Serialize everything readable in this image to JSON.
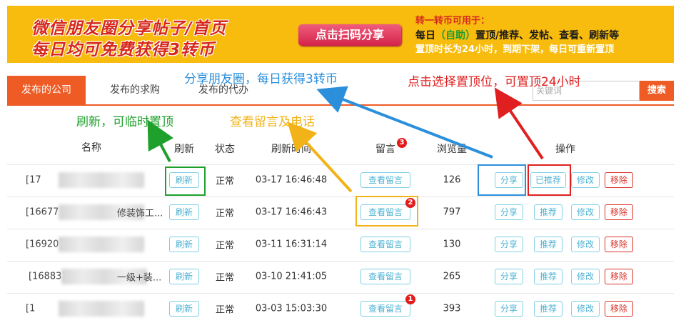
{
  "banner": {
    "title_line1": "微信朋友圈分享帖子/首页",
    "title_line2": "每日均可免费获得3转币",
    "scan_button": "点击扫码分享",
    "info_line1": "转一转币可用于：",
    "info_line2_a": "每日",
    "info_line2_b": "（自助）",
    "info_line2_c": "置顶/推荐、发帖、查看、刷新等",
    "info_line3": "置顶时长为24小时，到期下架，每日可重新置顶"
  },
  "tabs": [
    "发布的公司",
    "发布的求购",
    "发布的代办"
  ],
  "search": {
    "placeholder": "关键词",
    "button": "搜索"
  },
  "headers": {
    "name": "名称",
    "refresh": "刷新",
    "status": "状态",
    "refresh_time": "刷新时间",
    "messages": "留言",
    "views": "浏览量",
    "actions": "操作"
  },
  "header_badge": "3",
  "buttons": {
    "refresh": "刷新",
    "view_messages": "查看留言",
    "share": "分享",
    "recommend": "推荐",
    "recommended": "已推荐",
    "edit": "修改",
    "remove": "移除"
  },
  "rows": [
    {
      "name_visible": "[17",
      "name_tail": "",
      "status": "正常",
      "time": "03-17 16:46:48",
      "views": "126",
      "badge": "",
      "recommend_label": "已推荐"
    },
    {
      "name_visible": "[16677",
      "name_tail": "修装饰工...",
      "status": "正常",
      "time": "03-17 16:46:43",
      "views": "797",
      "badge": "2",
      "recommend_label": "推荐"
    },
    {
      "name_visible": "[16920]",
      "name_tail": "",
      "status": "正常",
      "time": "03-11 16:31:14",
      "views": "130",
      "badge": "",
      "recommend_label": "推荐"
    },
    {
      "name_visible": "[16883]",
      "name_tail": "一级+装...",
      "status": "正常",
      "time": "03-10 21:41:05",
      "views": "265",
      "badge": "",
      "recommend_label": "推荐"
    },
    {
      "name_visible": "[1",
      "name_tail": "",
      "status": "正常",
      "time": "03-03 15:03:30",
      "views": "393",
      "badge": "1",
      "recommend_label": "推荐"
    }
  ],
  "annotations": {
    "share_note": "分享朋友圈，每日获得3转币",
    "top_note": "点击选择置顶位，可置顶24小时",
    "refresh_note": "刷新，可临时置顶",
    "message_note": "查看留言及电话"
  },
  "colors": {
    "banner_bg": "#f8bc0e",
    "accent_orange": "#ee5b25",
    "button_blue": "#4fb3d4",
    "remove_red": "#d9332b",
    "note_blue": "#2b8fdc",
    "note_red": "#e02020",
    "note_green": "#1fa02d",
    "note_yellow": "#f2b318"
  }
}
